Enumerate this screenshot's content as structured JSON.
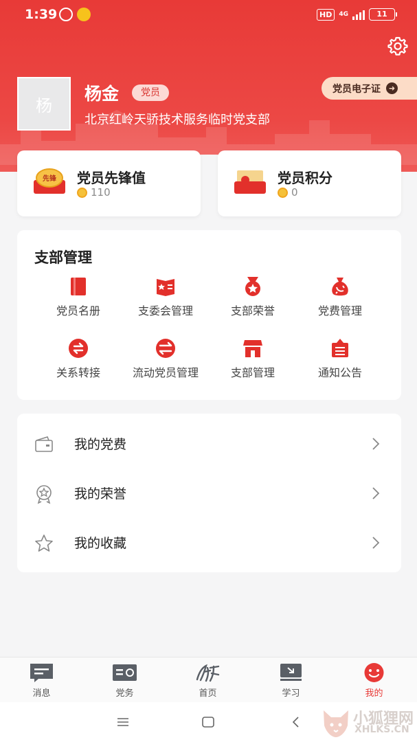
{
  "status_bar": {
    "time": "1:39",
    "network": "HD",
    "signal_label": "4G",
    "battery": "11"
  },
  "profile": {
    "avatar_text": "杨",
    "name": "杨金",
    "role_badge": "党员",
    "organization": "北京红岭天骄技术服务临时党支部",
    "cert_button": "党员电子证"
  },
  "stats": [
    {
      "title": "党员先锋值",
      "value": "110",
      "icon": "pioneer-badge-icon"
    },
    {
      "title": "党员积分",
      "value": "0",
      "icon": "points-envelope-icon"
    }
  ],
  "branch_management": {
    "title": "支部管理",
    "items": [
      {
        "label": "党员名册",
        "icon": "roster-book-icon"
      },
      {
        "label": "支委会管理",
        "icon": "committee-icon"
      },
      {
        "label": "支部荣誉",
        "icon": "honor-medal-icon"
      },
      {
        "label": "党费管理",
        "icon": "money-bag-icon"
      },
      {
        "label": "关系转接",
        "icon": "transfer-icon"
      },
      {
        "label": "流动党员管理",
        "icon": "mobile-member-icon"
      },
      {
        "label": "支部管理",
        "icon": "branch-store-icon"
      },
      {
        "label": "通知公告",
        "icon": "notice-icon"
      }
    ]
  },
  "menu": [
    {
      "label": "我的党费",
      "icon": "wallet-icon"
    },
    {
      "label": "我的荣誉",
      "icon": "medal-icon"
    },
    {
      "label": "我的收藏",
      "icon": "star-icon"
    }
  ],
  "tabbar": [
    {
      "label": "消息",
      "icon": "message-icon",
      "active": false
    },
    {
      "label": "党务",
      "icon": "party-affairs-icon",
      "active": false
    },
    {
      "label": "首页",
      "icon": "home-calligraphy-icon",
      "active": false
    },
    {
      "label": "学习",
      "icon": "study-icon",
      "active": false
    },
    {
      "label": "我的",
      "icon": "mine-smile-icon",
      "active": true
    }
  ],
  "watermark": {
    "cn": "小狐狸网",
    "en": "XHLKS.CN"
  },
  "colors": {
    "primary": "#e83a37",
    "background": "#f5f5f6",
    "cert_bg": "#fcdcc7"
  }
}
